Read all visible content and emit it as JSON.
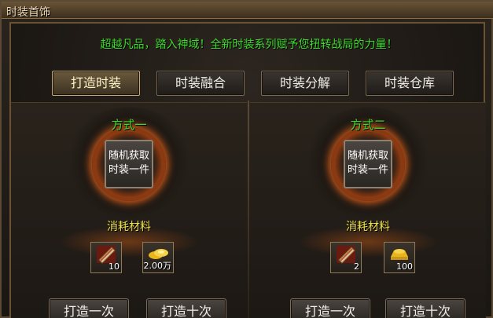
{
  "window": {
    "title": "时装首饰"
  },
  "slogan": "超越凡品，踏入神域！全新时装系列赋予您扭转战局的力量！",
  "tabs": [
    {
      "label": "打造时装",
      "active": true
    },
    {
      "label": "时装融合",
      "active": false
    },
    {
      "label": "时装分解",
      "active": false
    },
    {
      "label": "时装仓库",
      "active": false
    }
  ],
  "panels": [
    {
      "method": "方式一",
      "random_line1": "随机获取",
      "random_line2": "时装一件",
      "cost_label": "消耗材料",
      "materials": [
        {
          "icon": "scroll-icon",
          "qty": "10"
        },
        {
          "icon": "gold-ingot-icon",
          "qty": "2.00万"
        }
      ],
      "buttons": {
        "once": "打造一次",
        "ten": "打造十次"
      }
    },
    {
      "method": "方式二",
      "random_line1": "随机获取",
      "random_line2": "时装一件",
      "cost_label": "消耗材料",
      "materials": [
        {
          "icon": "scroll-icon",
          "qty": "2"
        },
        {
          "icon": "gold-ingot-icon",
          "qty": "100"
        }
      ],
      "buttons": {
        "once": "打造一次",
        "ten": "打造十次"
      }
    }
  ],
  "colors": {
    "slogan": "#3edb2e",
    "method_label": "#3edb2e",
    "cost_label": "#f0e24a",
    "ring_glow": "#d05a18"
  }
}
